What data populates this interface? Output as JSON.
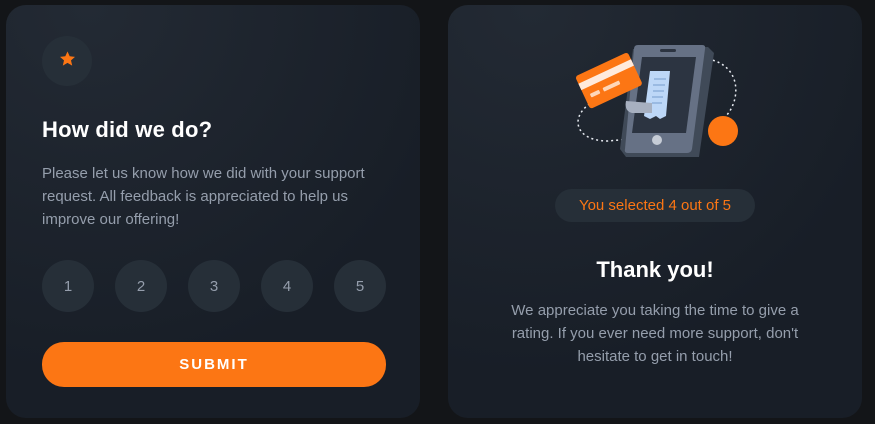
{
  "rating_card": {
    "title": "How did we do?",
    "description": "Please let us know how we did with your support request. All feedback is appreciated to help us improve our offering!",
    "ratings": [
      "1",
      "2",
      "3",
      "4",
      "5"
    ],
    "submit_label": "SUBMIT",
    "icon": "star-icon"
  },
  "thanks_card": {
    "selected_text": "You selected 4 out of 5",
    "title": "Thank you!",
    "description": "We appreciate you taking the time to give a rating. If you ever need more support, don't hesitate to get in touch!",
    "illustration": "phone-receipt-card-illustration"
  },
  "colors": {
    "background": "#131518",
    "card": "#181e27",
    "accent": "#fc7614",
    "muted": "#959eac",
    "circle": "#262f38",
    "white": "#ffffff"
  }
}
